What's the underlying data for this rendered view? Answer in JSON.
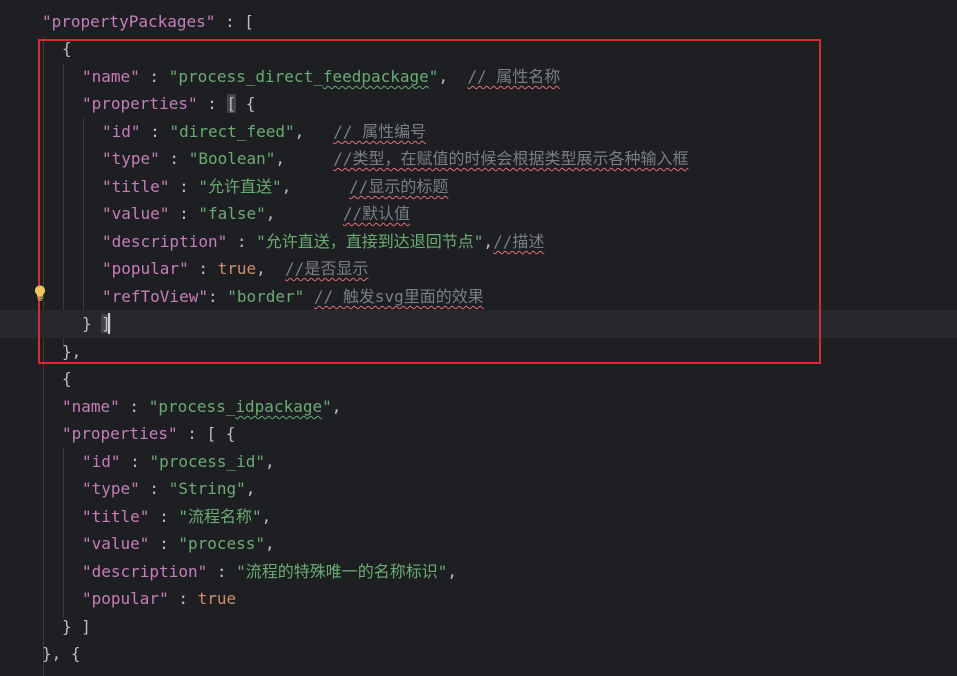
{
  "lines": [
    {
      "segs": [
        [
          "tok-key",
          "\"propertyPackages\""
        ],
        [
          "tok-punc",
          " : ["
        ]
      ]
    },
    {
      "segs": [
        [
          "tok-punc",
          "{"
        ]
      ]
    },
    {
      "segs": [
        [
          "tok-key",
          "\"name\""
        ],
        [
          "tok-punc",
          " : "
        ],
        [
          "tok-str",
          "\"process_direct_"
        ],
        [
          "tok-str squig",
          "feedpackage"
        ],
        [
          "tok-str",
          "\""
        ],
        [
          "tok-punc",
          ",  "
        ],
        [
          "tok-com squig",
          "// 属性名称"
        ]
      ]
    },
    {
      "segs": [
        [
          "tok-key",
          "\"properties\""
        ],
        [
          "tok-punc",
          " : "
        ],
        [
          "tok-punc bracket-hl",
          "["
        ],
        [
          "tok-punc",
          " {"
        ]
      ]
    },
    {
      "segs": [
        [
          "tok-key",
          "\"id\""
        ],
        [
          "tok-punc",
          " : "
        ],
        [
          "tok-str",
          "\"direct_feed\""
        ],
        [
          "tok-punc",
          ",   "
        ],
        [
          "tok-com squig",
          "// 属性编号"
        ]
      ]
    },
    {
      "segs": [
        [
          "tok-key",
          "\"type\""
        ],
        [
          "tok-punc",
          " : "
        ],
        [
          "tok-str",
          "\"Boolean\""
        ],
        [
          "tok-punc",
          ",     "
        ],
        [
          "tok-com squig",
          "//类型，在赋值的时候会根据类型展示各种输入框"
        ]
      ]
    },
    {
      "segs": [
        [
          "tok-key",
          "\"title\""
        ],
        [
          "tok-punc",
          " : "
        ],
        [
          "tok-str",
          "\"允许直送\""
        ],
        [
          "tok-punc",
          ",      "
        ],
        [
          "tok-com squig",
          "//显示的标题"
        ]
      ]
    },
    {
      "segs": [
        [
          "tok-key",
          "\"value\""
        ],
        [
          "tok-punc",
          " : "
        ],
        [
          "tok-str",
          "\"false\""
        ],
        [
          "tok-punc",
          ",       "
        ],
        [
          "tok-com squig",
          "//默认值"
        ]
      ]
    },
    {
      "segs": [
        [
          "tok-key",
          "\"description\""
        ],
        [
          "tok-punc",
          " : "
        ],
        [
          "tok-str",
          "\"允许直送，直接到达退回节点\""
        ],
        [
          "tok-punc",
          ","
        ],
        [
          "tok-com squig",
          "//描述"
        ]
      ]
    },
    {
      "segs": [
        [
          "tok-key",
          "\"popular\""
        ],
        [
          "tok-punc",
          " : "
        ],
        [
          "tok-bool",
          "true"
        ],
        [
          "tok-punc",
          ",  "
        ],
        [
          "tok-com squig",
          "//是否显示"
        ]
      ]
    },
    {
      "segs": [
        [
          "tok-key",
          "\"refToView\""
        ],
        [
          "tok-punc",
          ": "
        ],
        [
          "tok-str",
          "\"border\""
        ],
        [
          "tok-punc",
          " "
        ],
        [
          "tok-com squig",
          "// 触发svg里面的效果"
        ]
      ]
    },
    {
      "segs": [
        [
          "tok-punc",
          "} "
        ],
        [
          "tok-punc bracket-hl",
          "]"
        ]
      ]
    },
    {
      "segs": [
        [
          "tok-punc",
          "},"
        ]
      ]
    },
    {
      "segs": [
        [
          "tok-punc",
          "{"
        ]
      ]
    },
    {
      "segs": [
        [
          "tok-key",
          "\"name\""
        ],
        [
          "tok-punc",
          " : "
        ],
        [
          "tok-str",
          "\"process_"
        ],
        [
          "tok-str squig",
          "idpackage"
        ],
        [
          "tok-str",
          "\""
        ],
        [
          "tok-punc",
          ","
        ]
      ]
    },
    {
      "segs": [
        [
          "tok-key",
          "\"properties\""
        ],
        [
          "tok-punc",
          " : [ {"
        ]
      ]
    },
    {
      "segs": [
        [
          "tok-key",
          "\"id\""
        ],
        [
          "tok-punc",
          " : "
        ],
        [
          "tok-str",
          "\"process_id\""
        ],
        [
          "tok-punc",
          ","
        ]
      ]
    },
    {
      "segs": [
        [
          "tok-key",
          "\"type\""
        ],
        [
          "tok-punc",
          " : "
        ],
        [
          "tok-str",
          "\"String\""
        ],
        [
          "tok-punc",
          ","
        ]
      ]
    },
    {
      "segs": [
        [
          "tok-key",
          "\"title\""
        ],
        [
          "tok-punc",
          " : "
        ],
        [
          "tok-str",
          "\"流程名称\""
        ],
        [
          "tok-punc",
          ","
        ]
      ]
    },
    {
      "segs": [
        [
          "tok-key",
          "\"value\""
        ],
        [
          "tok-punc",
          " : "
        ],
        [
          "tok-str",
          "\"process\""
        ],
        [
          "tok-punc",
          ","
        ]
      ]
    },
    {
      "segs": [
        [
          "tok-key",
          "\"description\""
        ],
        [
          "tok-punc",
          " : "
        ],
        [
          "tok-str",
          "\"流程的特殊唯一的名称标识\""
        ],
        [
          "tok-punc",
          ","
        ]
      ]
    },
    {
      "segs": [
        [
          "tok-key",
          "\"popular\""
        ],
        [
          "tok-punc",
          " : "
        ],
        [
          "tok-bool",
          "true"
        ]
      ]
    },
    {
      "segs": [
        [
          "tok-punc",
          "} ]"
        ]
      ]
    },
    {
      "segs": [
        [
          "tok-punc",
          "}, {"
        ]
      ]
    }
  ],
  "colors": {
    "background": "#1e1f22",
    "highlight_box": "#e0262e",
    "key": "#c77dbb",
    "string": "#6aab73",
    "keyword": "#cf8e6d",
    "comment": "#7a7e85"
  },
  "icons": {
    "gutter": "lightbulb-icon"
  }
}
